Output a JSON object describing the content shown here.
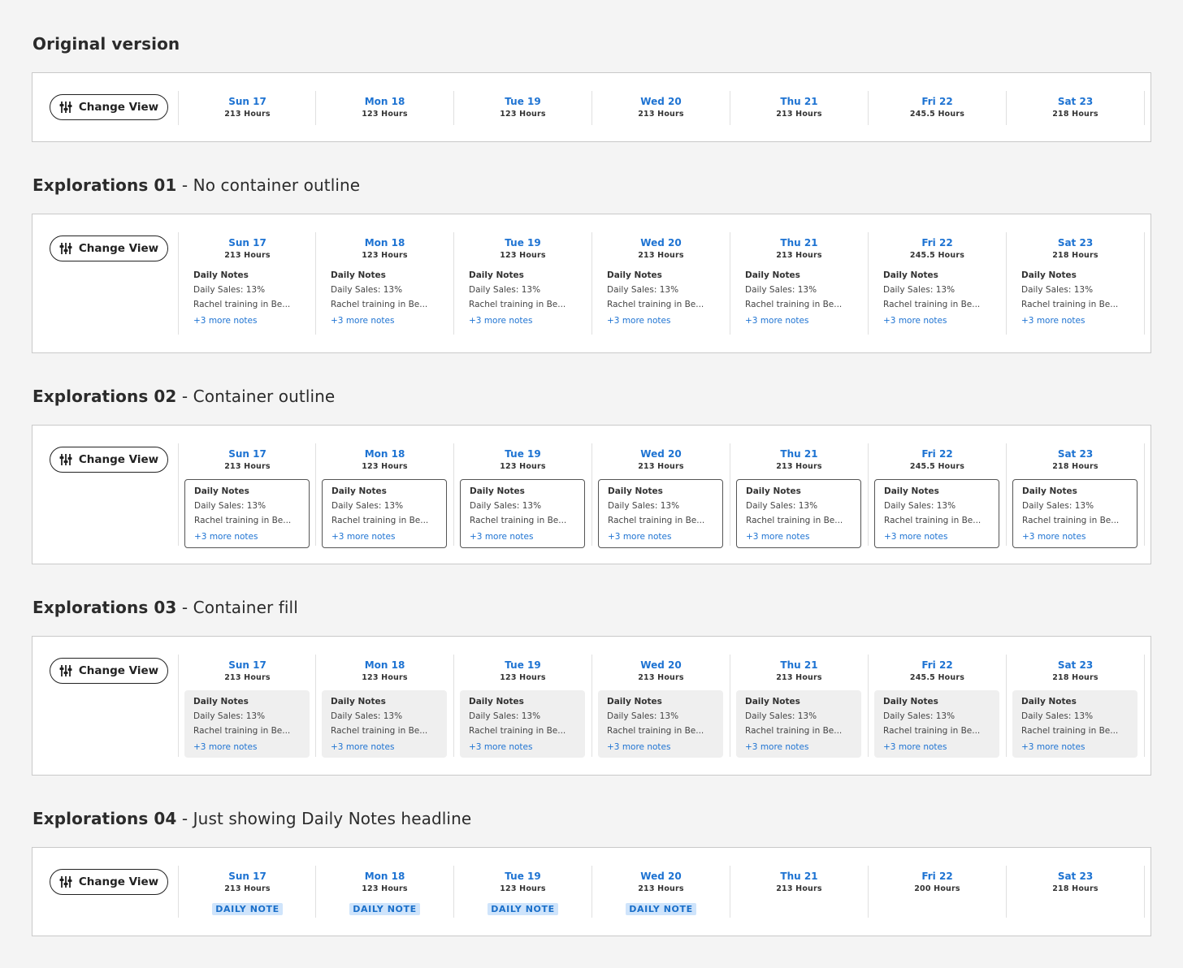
{
  "change_view_label": "Change View",
  "notes": {
    "title": "Daily Notes",
    "line1": "Daily Sales: 13%",
    "line2": "Rachel training in Be...",
    "more": "+3 more notes"
  },
  "badge_label": "DAILY NOTE",
  "days": [
    {
      "name": "Sun 17",
      "hours": "213 Hours"
    },
    {
      "name": "Mon 18",
      "hours": "123 Hours"
    },
    {
      "name": "Tue 19",
      "hours": "123 Hours"
    },
    {
      "name": "Wed 20",
      "hours": "213 Hours"
    },
    {
      "name": "Thu 21",
      "hours": "213 Hours"
    },
    {
      "name": "Fri 22",
      "hours": "245.5 Hours"
    },
    {
      "name": "Sat 23",
      "hours": "218 Hours"
    }
  ],
  "days_v4": [
    {
      "name": "Sun 17",
      "hours": "213 Hours",
      "badge": true
    },
    {
      "name": "Mon 18",
      "hours": "123 Hours",
      "badge": true
    },
    {
      "name": "Tue 19",
      "hours": "123 Hours",
      "badge": true
    },
    {
      "name": "Wed 20",
      "hours": "213 Hours",
      "badge": true
    },
    {
      "name": "Thu 21",
      "hours": "213 Hours",
      "badge": false
    },
    {
      "name": "Fri 22",
      "hours": "200 Hours",
      "badge": false
    },
    {
      "name": "Sat 23",
      "hours": "218 Hours",
      "badge": false
    }
  ],
  "sections": [
    {
      "title": "Original  version",
      "subtitle": "",
      "variant": "original"
    },
    {
      "title": "Explorations 01",
      "subtitle": " - No container outline",
      "variant": "plain"
    },
    {
      "title": "Explorations 02",
      "subtitle": " - Container outline",
      "variant": "outline"
    },
    {
      "title": "Explorations 03",
      "subtitle": " - Container fill",
      "variant": "fill"
    },
    {
      "title": "Explorations 04",
      "subtitle": " - Just showing Daily Notes headline",
      "variant": "badge"
    }
  ],
  "colors": {
    "accent": "#1e73d2",
    "badge_bg": "#cfe4fb",
    "fill_bg": "#efefef"
  },
  "icons": {
    "change_view": "sliders-icon"
  }
}
